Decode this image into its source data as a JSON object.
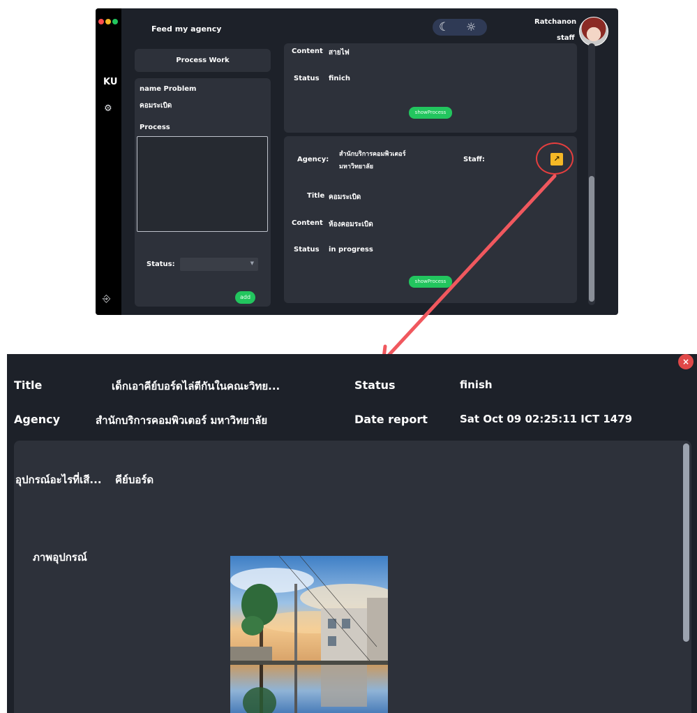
{
  "app": {
    "title": "Feed my agency",
    "rail": {
      "logo": "KU",
      "settings_icon": "gear-icon",
      "logout_icon": "logout-icon"
    },
    "theme_toggle": {
      "dark_icon": "moon-icon",
      "light_icon": "sun-icon"
    },
    "user": {
      "name": "Ratchanon",
      "role": "staff"
    }
  },
  "left_panel": {
    "process_work_button": "Process Work",
    "name_problem_label": "name Problem",
    "name_problem_value": "คอมระเบิด",
    "process_label": "Process",
    "status_label": "Status:",
    "status_value": "",
    "add_button": "add"
  },
  "cards": [
    {
      "content_label": "Content",
      "content_value": "สายไฟ",
      "status_label": "Status",
      "status_value": "finich",
      "show_button": "showProcess"
    },
    {
      "agency_label": "Agency:",
      "agency_value_line1": "สำนักบริการคอมพิวเตอร์",
      "agency_value_line2": "มหาวิทยาลัย",
      "staff_label": "Staff:",
      "title_label": "Title",
      "title_value": "คอมระเบิด",
      "content_label": "Content",
      "content_value": "ห้องคอมระเบิด",
      "status_label": "Status",
      "status_value": "in progress",
      "show_button": "showProcess",
      "expand_icon": "arrow-up-right-icon"
    }
  ],
  "detail": {
    "close_icon": "close-icon",
    "title_label": "Title",
    "title_value": "เด็กเอาคีย์บอร์ดไล่ตีกันในคณะวิทย...",
    "status_label": "Status",
    "status_value": "finish",
    "agency_label": "Agency",
    "agency_value": "สำนักบริการคอมพิวเตอร์ มหาวิทยาลัย",
    "date_label": "Date report",
    "date_value": "Sat Oct 09 02:25:11 ICT 1479",
    "device_question_label": "อุปกรณ์อะไรที่เสี...",
    "device_question_value": "คีย์บอร์ด",
    "device_photo_label": "ภาพอุปกรณ์"
  },
  "colors": {
    "window_bg": "#1d2129",
    "panel_bg": "#2d313a",
    "accent_green": "#22c55e",
    "accent_yellow": "#f5b826",
    "annotation_red": "#e53e3e"
  }
}
